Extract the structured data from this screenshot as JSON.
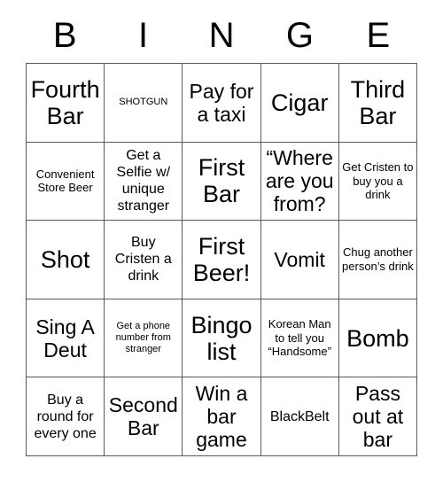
{
  "header": {
    "letters": [
      "B",
      "I",
      "N",
      "G",
      "E"
    ]
  },
  "grid": {
    "rows": 5,
    "columns": 5,
    "border_color": "#595959",
    "background_color": "#ffffff",
    "text_color": "#000000",
    "cells": [
      {
        "text": "Fourth Bar",
        "size": "xl"
      },
      {
        "text": "SHOTGUN",
        "size": "xs"
      },
      {
        "text": "Pay for a taxi",
        "size": "lg"
      },
      {
        "text": "Cigar",
        "size": "xl"
      },
      {
        "text": "Third Bar",
        "size": "xl"
      },
      {
        "text": "Convenient Store Beer",
        "size": "sm"
      },
      {
        "text": "Get a Selfie w/ unique stranger",
        "size": "md"
      },
      {
        "text": "First Bar",
        "size": "xl"
      },
      {
        "text": "“Where are you from?",
        "size": "lg"
      },
      {
        "text": "Get Cristen to buy you a drink",
        "size": "sm"
      },
      {
        "text": "Shot",
        "size": "xl"
      },
      {
        "text": "Buy Cristen a drink",
        "size": "md"
      },
      {
        "text": "First Beer!",
        "size": "xl"
      },
      {
        "text": "Vomit",
        "size": "lg"
      },
      {
        "text": "Chug another person’s drink",
        "size": "sm"
      },
      {
        "text": "Sing A Deut",
        "size": "lg"
      },
      {
        "text": "Get a phone number from stranger",
        "size": "xs"
      },
      {
        "text": "Bingo list",
        "size": "xl"
      },
      {
        "text": "Korean Man to tell you “Handsome”",
        "size": "sm"
      },
      {
        "text": "Bomb",
        "size": "xl"
      },
      {
        "text": "Buy a round for every one",
        "size": "md"
      },
      {
        "text": "Second Bar",
        "size": "lg"
      },
      {
        "text": "Win a bar game",
        "size": "lg"
      },
      {
        "text": "BlackBelt",
        "size": "md"
      },
      {
        "text": "Pass out at bar",
        "size": "lg"
      }
    ]
  }
}
